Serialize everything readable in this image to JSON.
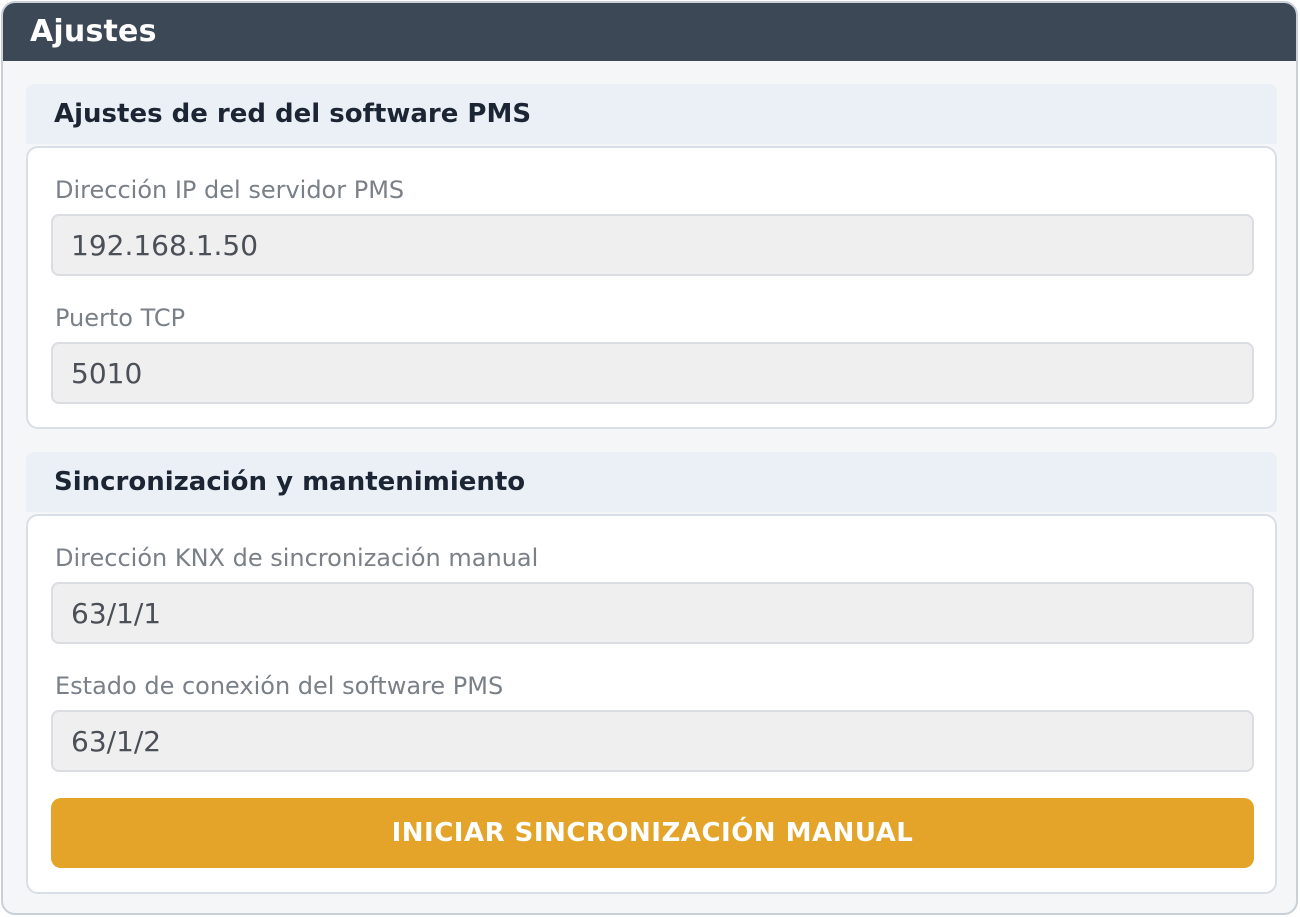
{
  "window": {
    "title": "Ajustes"
  },
  "sections": [
    {
      "title": "Ajustes de red del software PMS",
      "fields": [
        {
          "label": "Dirección IP del servidor PMS",
          "value": "192.168.1.50"
        },
        {
          "label": "Puerto TCP",
          "value": "5010"
        }
      ]
    },
    {
      "title": "Sincronización y mantenimiento",
      "fields": [
        {
          "label": "Dirección KNX de sincronización manual",
          "value": "63/1/1"
        },
        {
          "label": "Estado de conexión del software PMS",
          "value": "63/1/2"
        }
      ],
      "button_label": "INICIAR SINCRONIZACIÓN MANUAL"
    }
  ],
  "colors": {
    "titlebar": "#3d4856",
    "accent_button": "#e3a429",
    "section_header_bg": "#eaf0f6",
    "input_bg": "#efefef"
  }
}
